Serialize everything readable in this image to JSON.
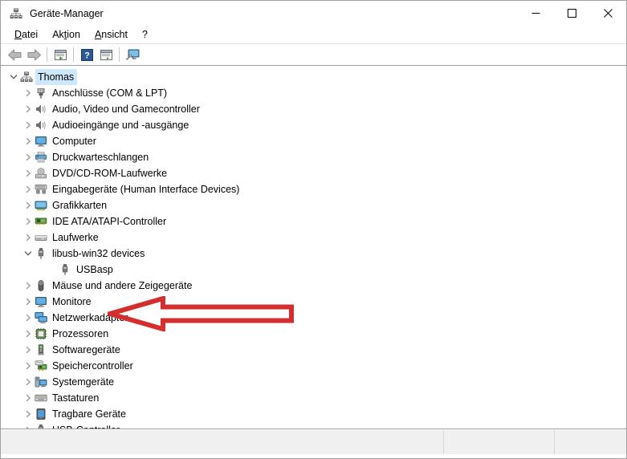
{
  "window": {
    "title": "Geräte-Manager",
    "app_icon": "device-manager-icon",
    "controls": {
      "minimize": "minimize-icon",
      "maximize": "maximize-icon",
      "close": "close-icon"
    }
  },
  "menubar": {
    "items": [
      {
        "label": "Datei",
        "accel": "D"
      },
      {
        "label": "Aktion",
        "accel": "t"
      },
      {
        "label": "Ansicht",
        "accel": "A"
      },
      {
        "label": "?",
        "accel": ""
      }
    ]
  },
  "toolbar": {
    "buttons": [
      {
        "name": "back-button",
        "icon": "back-arrow-icon"
      },
      {
        "name": "forward-button",
        "icon": "forward-arrow-icon"
      },
      {
        "name": "properties-button",
        "icon": "properties-icon"
      },
      {
        "name": "help-button",
        "icon": "help-question-icon"
      },
      {
        "name": "update-driver-button",
        "icon": "update-driver-icon"
      },
      {
        "name": "scan-hardware-button",
        "icon": "scan-hardware-icon"
      }
    ]
  },
  "tree": {
    "nodes": [
      {
        "label": "Thomas",
        "depth": 0,
        "state": "expanded",
        "icon": "computer-root-icon",
        "selected": true
      },
      {
        "label": "Anschlüsse (COM & LPT)",
        "depth": 1,
        "state": "collapsed",
        "icon": "port-icon",
        "selected": false
      },
      {
        "label": "Audio, Video und Gamecontroller",
        "depth": 1,
        "state": "collapsed",
        "icon": "speaker-icon",
        "selected": false
      },
      {
        "label": "Audioeingänge und -ausgänge",
        "depth": 1,
        "state": "collapsed",
        "icon": "speaker-icon",
        "selected": false
      },
      {
        "label": "Computer",
        "depth": 1,
        "state": "collapsed",
        "icon": "monitor-icon",
        "selected": false
      },
      {
        "label": "Druckwarteschlangen",
        "depth": 1,
        "state": "collapsed",
        "icon": "printer-icon",
        "selected": false
      },
      {
        "label": "DVD/CD-ROM-Laufwerke",
        "depth": 1,
        "state": "collapsed",
        "icon": "disc-drive-icon",
        "selected": false
      },
      {
        "label": "Eingabegeräte (Human Interface Devices)",
        "depth": 1,
        "state": "collapsed",
        "icon": "hid-icon",
        "selected": false
      },
      {
        "label": "Grafikkarten",
        "depth": 1,
        "state": "collapsed",
        "icon": "graphics-card-icon",
        "selected": false
      },
      {
        "label": "IDE ATA/ATAPI-Controller",
        "depth": 1,
        "state": "collapsed",
        "icon": "controller-card-icon",
        "selected": false
      },
      {
        "label": "Laufwerke",
        "depth": 1,
        "state": "collapsed",
        "icon": "disk-drive-icon",
        "selected": false
      },
      {
        "label": "libusb-win32 devices",
        "depth": 1,
        "state": "expanded",
        "icon": "usb-icon",
        "selected": false
      },
      {
        "label": "USBasp",
        "depth": 2,
        "state": "leaf",
        "icon": "usb-icon",
        "selected": false
      },
      {
        "label": "Mäuse und andere Zeigegeräte",
        "depth": 1,
        "state": "collapsed",
        "icon": "mouse-icon",
        "selected": false
      },
      {
        "label": "Monitore",
        "depth": 1,
        "state": "collapsed",
        "icon": "monitor-icon",
        "selected": false
      },
      {
        "label": "Netzwerkadapter",
        "depth": 1,
        "state": "collapsed",
        "icon": "network-icon",
        "selected": false
      },
      {
        "label": "Prozessoren",
        "depth": 1,
        "state": "collapsed",
        "icon": "processor-icon",
        "selected": false
      },
      {
        "label": "Softwaregeräte",
        "depth": 1,
        "state": "collapsed",
        "icon": "software-device-icon",
        "selected": false
      },
      {
        "label": "Speichercontroller",
        "depth": 1,
        "state": "collapsed",
        "icon": "storage-controller-icon",
        "selected": false
      },
      {
        "label": "Systemgeräte",
        "depth": 1,
        "state": "collapsed",
        "icon": "system-device-icon",
        "selected": false
      },
      {
        "label": "Tastaturen",
        "depth": 1,
        "state": "collapsed",
        "icon": "keyboard-icon",
        "selected": false
      },
      {
        "label": "Tragbare Geräte",
        "depth": 1,
        "state": "collapsed",
        "icon": "portable-device-icon",
        "selected": false
      },
      {
        "label": "USB-Controller",
        "depth": 1,
        "state": "collapsed",
        "icon": "usb-icon",
        "selected": false
      }
    ]
  },
  "annotation": {
    "shape": "left-arrow-outline",
    "color": "#d32f2f",
    "points_at": "USBasp"
  },
  "statusbar": {
    "main": "",
    "segment_2": "",
    "segment_3": ""
  },
  "colors": {
    "selection": "#cde8ff",
    "annotation_red": "#d32f2f",
    "window_border": "#a0a0a0",
    "statusbar_bg": "#f0f0f0"
  }
}
